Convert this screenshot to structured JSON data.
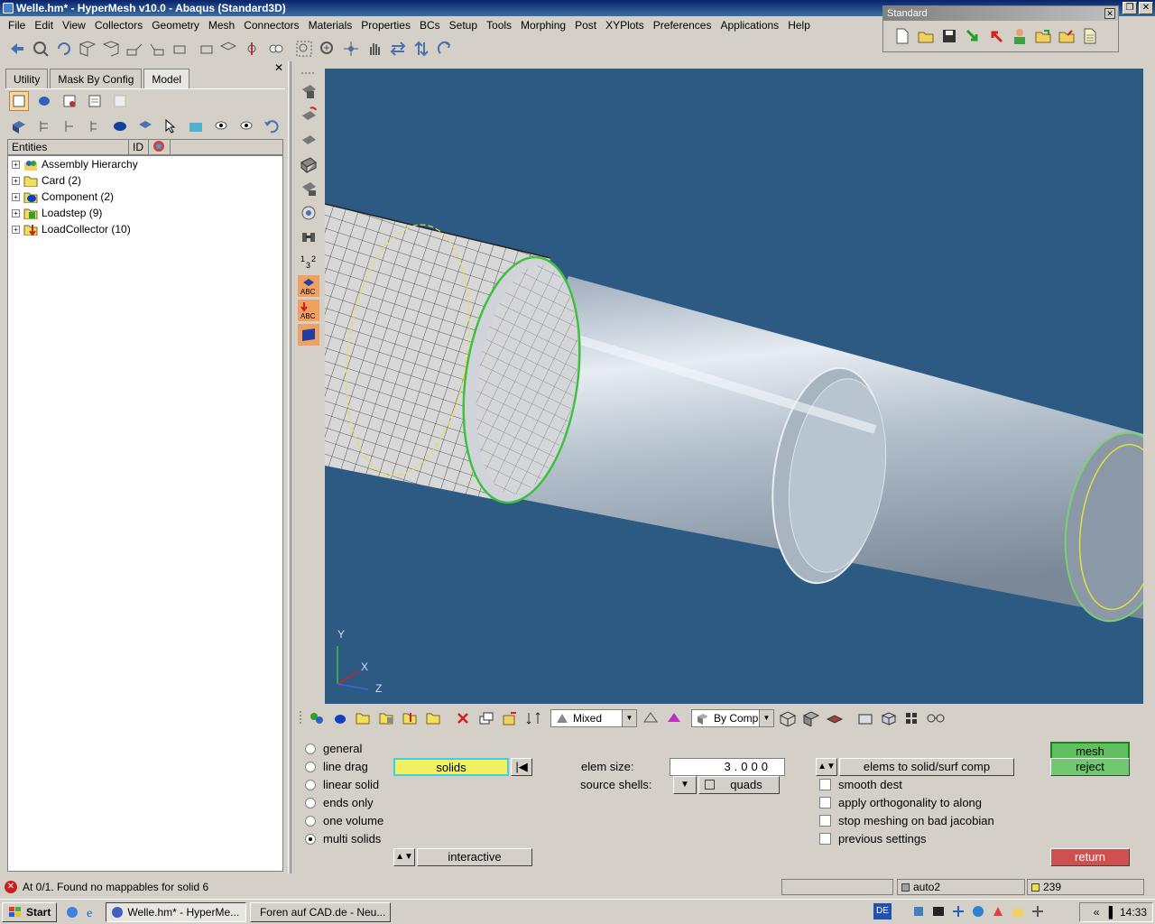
{
  "window": {
    "title": "Welle.hm* - HyperMesh v10.0 - Abaqus (Standard3D)"
  },
  "menu": [
    "File",
    "Edit",
    "View",
    "Collectors",
    "Geometry",
    "Mesh",
    "Connectors",
    "Materials",
    "Properties",
    "BCs",
    "Setup",
    "Tools",
    "Morphing",
    "Post",
    "XYPlots",
    "Preferences",
    "Applications",
    "Help"
  ],
  "standard_toolbar": {
    "title": "Standard"
  },
  "left_panel": {
    "tabs": [
      "Utility",
      "Mask By Config",
      "Model"
    ],
    "active_tab": "Model",
    "columns": {
      "entities": "Entities",
      "id": "ID"
    },
    "tree": [
      {
        "label": "Assembly Hierarchy"
      },
      {
        "label": "Card (2)"
      },
      {
        "label": "Component (2)"
      },
      {
        "label": "Loadstep (9)"
      },
      {
        "label": "LoadCollector (10)"
      }
    ]
  },
  "viewport": {
    "axis_y": "Y",
    "axis_x": "X",
    "axis_z": "Z",
    "background": "#2d5a82"
  },
  "bottom_bar": {
    "display_mode": "Mixed",
    "color_mode": "By Comp"
  },
  "panel": {
    "radios": [
      {
        "label": "general",
        "selected": false
      },
      {
        "label": "line drag",
        "selected": false
      },
      {
        "label": "linear solid",
        "selected": false
      },
      {
        "label": "ends only",
        "selected": false
      },
      {
        "label": "one volume",
        "selected": false
      },
      {
        "label": "multi solids",
        "selected": true
      }
    ],
    "selector": "solids",
    "interactive": "interactive",
    "elem_size_label": "elem size:",
    "elem_size_value": "3.000",
    "source_shells_label": "source shells:",
    "source_shells_value": "quads",
    "comp_option": "elems to solid/surf comp",
    "checkboxes": [
      "smooth dest",
      "apply orthogonality to along",
      "stop meshing on bad jacobian",
      "previous settings"
    ],
    "mesh_button": "mesh",
    "reject_button": "reject",
    "return_button": "return"
  },
  "status": {
    "message": "At 0/1. Found no mappables for solid 6",
    "component": "auto2",
    "count": "239"
  },
  "taskbar": {
    "start": "Start",
    "tasks": [
      "Welle.hm* - HyperMe...",
      "Foren auf CAD.de - Neu..."
    ],
    "lang": "DE",
    "time": "14:33"
  }
}
